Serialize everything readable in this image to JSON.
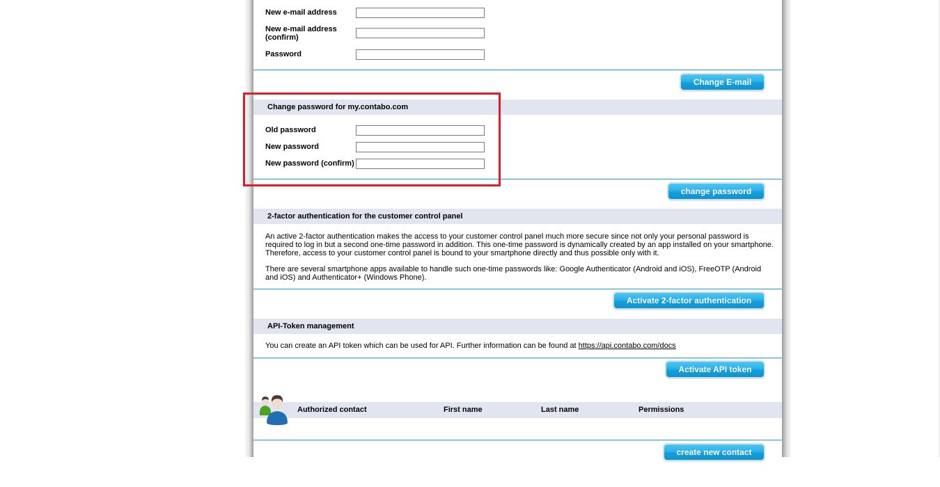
{
  "email_section": {
    "fields": [
      {
        "label": "New e-mail address",
        "value": "",
        "placeholder": ""
      },
      {
        "label": "New e-mail address (confirm)",
        "label_line1": "New e-mail address",
        "label_line2": "(confirm)",
        "value": "",
        "placeholder": ""
      },
      {
        "label": "Password",
        "value": "",
        "placeholder": ""
      }
    ],
    "button_label": "Change E-mail"
  },
  "password_section": {
    "title": "Change password for my.contabo.com",
    "fields": [
      {
        "label": "Old password",
        "value": "",
        "placeholder": ""
      },
      {
        "label": "New password",
        "value": "",
        "placeholder": ""
      },
      {
        "label": "New password (confirm)",
        "value": "",
        "placeholder": ""
      }
    ],
    "button_label": "change password"
  },
  "two_factor_section": {
    "title": "2-factor authentication for the customer control panel",
    "paragraph1_line1": "An active 2-factor authentication makes the access to your customer control panel much more secure since not only your personal password is",
    "paragraph1_line2": "required to log in but a second one-time password in addition. This one-time password is dynamically created by an app installed on your smartphone.",
    "paragraph1_line3": "Therefore, access to your customer control panel is bound to your smartphone directly and thus possible only with it.",
    "paragraph2_line1": "There are several smartphone apps available to handle such one-time passwords like: Google Authenticator (Android and iOS), FreeOTP (Android",
    "paragraph2_line2": "and iOS) and Authenticator+ (Windows Phone).",
    "button_label": "Activate 2-factor authentication"
  },
  "api_section": {
    "title": "API-Token management",
    "text": "You can create an API token which can be used for API. Further information can be found at ",
    "link_text": "https://api.contabo.com/docs",
    "button_label": "Activate API token"
  },
  "contacts_section": {
    "icon": "users-icon",
    "columns": [
      "Authorized contact",
      "First name",
      "Last name",
      "Permissions"
    ],
    "rows": [],
    "button_label": "create new contact"
  },
  "annotation": {
    "highlight_color": "#e21b24"
  },
  "colors": {
    "accent": "#1aa3dc",
    "section_header_bg": "#e1e5f0",
    "button_gradient_top": "#4fc6f2",
    "button_gradient_bottom": "#1193cc"
  }
}
